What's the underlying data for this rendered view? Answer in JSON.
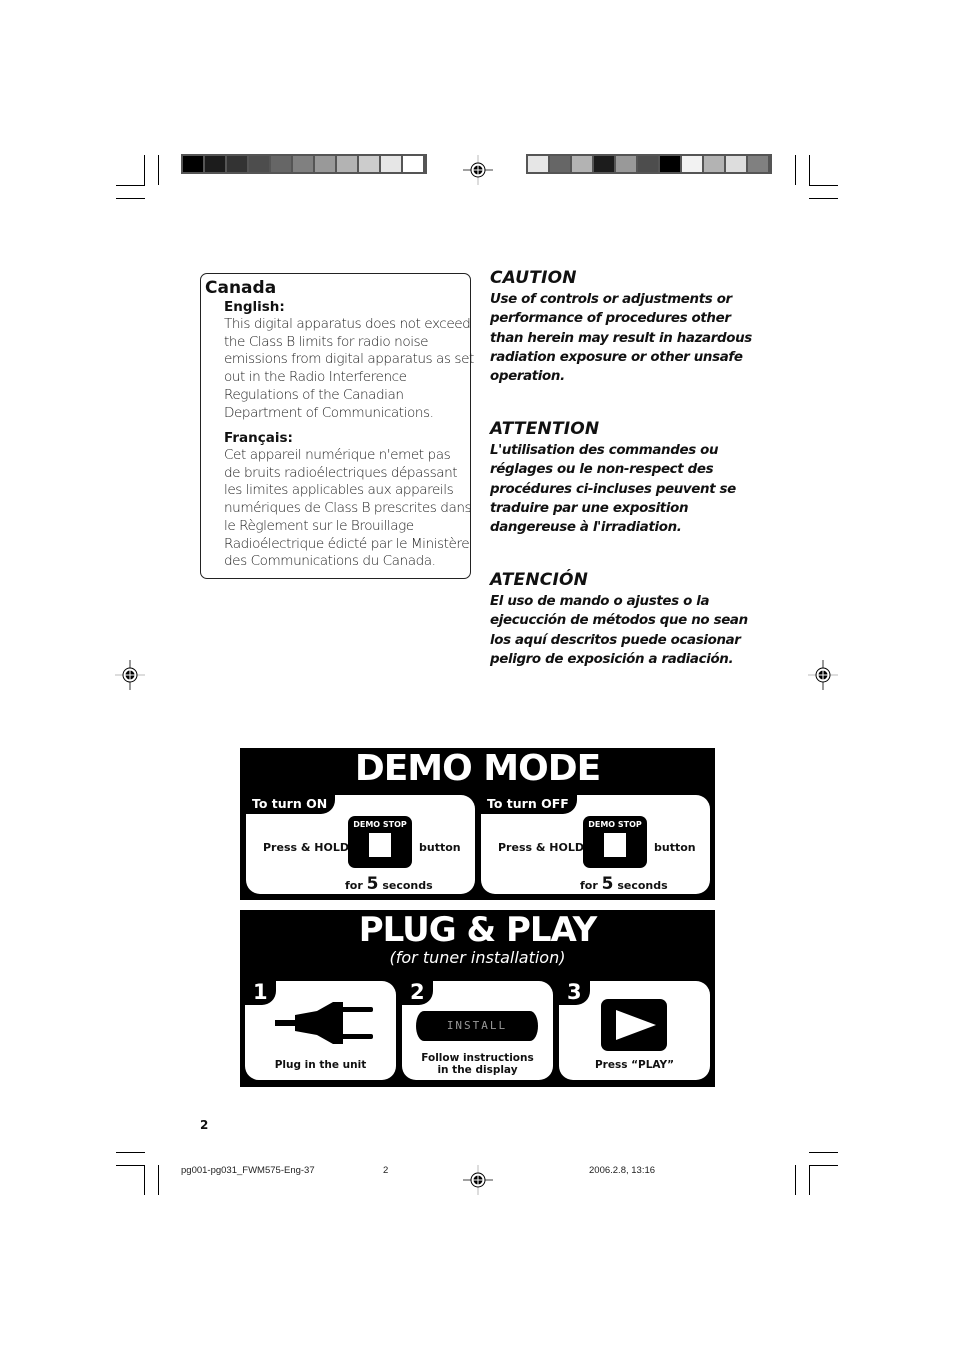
{
  "colors": {
    "ink": "#000000",
    "paper": "#ffffff"
  },
  "color_bars": {
    "left": [
      "#000000",
      "#1c1c1c",
      "#333333",
      "#4d4d4d",
      "#666666",
      "#808080",
      "#999999",
      "#b3b3b3",
      "#cccccc",
      "#e6e6e6",
      "#ffffff"
    ],
    "right": [
      "#e6e6e6",
      "#666666",
      "#b3b3b3",
      "#1c1c1c",
      "#999999",
      "#4d4d4d",
      "#000000",
      "#f2f2f2",
      "#b3b3b3",
      "#dddddd",
      "#808080"
    ]
  },
  "canada": {
    "title": "Canada",
    "english_heading": "English:",
    "english_text": "This digital apparatus does not exceed\nthe Class B limits for radio noise\nemissions from digital apparatus as set\nout in the Radio Interference\nRegulations of the Canadian\nDepartment of Communications.",
    "french_heading": "Français:",
    "french_text": "Cet appareil numérique n'emet pas\nde bruits radioélectriques dépassant\nles limites applicables aux appareils\nnumériques de Class B prescrites dans\nle Règlement sur le Brouillage\nRadioélectrique édicté par le Ministère\ndes Communications du Canada."
  },
  "warnings": [
    {
      "heading": "CAUTION",
      "text": "Use of controls or adjustments or\nperformance of procedures other\nthan herein may result in hazardous\nradiation exposure or other unsafe\noperation."
    },
    {
      "heading": "ATTENTION",
      "text": "L'utilisation des commandes ou\nréglages ou le non-respect des\nprocédures ci-incluses peuvent se\ntraduire par une exposition\ndangereuse à l'irradiation."
    },
    {
      "heading": "ATENCIÓN",
      "text": "El uso de mando o ajustes o la\nejecucción de métodos que no sean\nlos aquí descritos puede ocasionar\npeligro de exposición a radiación."
    }
  ],
  "demo_mode": {
    "title": "DEMO MODE",
    "cards": [
      {
        "tab": "To turn ON",
        "press_hold": "Press & HOLD",
        "button_label": "DEMO STOP",
        "button_word": "button",
        "for_word": "for",
        "seconds_value": "5",
        "seconds_word": "seconds"
      },
      {
        "tab": "To turn OFF",
        "press_hold": "Press & HOLD",
        "button_label": "DEMO STOP",
        "button_word": "button",
        "for_word": "for",
        "seconds_value": "5",
        "seconds_word": "seconds"
      }
    ]
  },
  "plug_play": {
    "title": "PLUG & PLAY",
    "subtitle": "(for tuner installation)",
    "steps": [
      {
        "number": "1",
        "icon": "plug-icon",
        "label": "Plug in the unit"
      },
      {
        "number": "2",
        "icon": "display-icon",
        "display_text": "INSTALL",
        "label_line1": "Follow instructions",
        "label_line2": "in the display"
      },
      {
        "number": "3",
        "icon": "play-icon",
        "label": "Press “PLAY”"
      }
    ]
  },
  "page_number": "2",
  "footer": {
    "file": "pg001-pg031_FWM575-Eng-37",
    "page": "2",
    "timestamp": "2006.2.8, 13:16"
  }
}
